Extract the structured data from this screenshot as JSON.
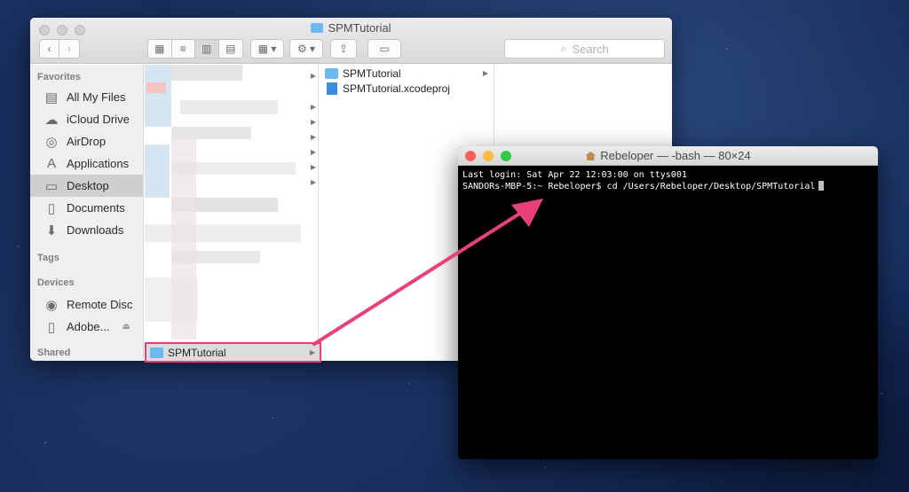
{
  "finder": {
    "title": "SPMTutorial",
    "search_placeholder": "Search",
    "sidebar": {
      "favorites_header": "Favorites",
      "favorites": [
        {
          "label": "All My Files",
          "icon": "all-files-icon"
        },
        {
          "label": "iCloud Drive",
          "icon": "cloud-icon"
        },
        {
          "label": "AirDrop",
          "icon": "airdrop-icon"
        },
        {
          "label": "Applications",
          "icon": "applications-icon"
        },
        {
          "label": "Desktop",
          "icon": "desktop-icon",
          "selected": true
        },
        {
          "label": "Documents",
          "icon": "documents-icon"
        },
        {
          "label": "Downloads",
          "icon": "downloads-icon"
        }
      ],
      "tags_header": "Tags",
      "devices_header": "Devices",
      "devices": [
        {
          "label": "Remote Disc",
          "icon": "disc-icon"
        },
        {
          "label": "Adobe...",
          "icon": "drive-icon"
        }
      ],
      "shared_header": "Shared"
    },
    "column1_selected": "SPMTutorial",
    "column2_items": [
      {
        "label": "SPMTutorial",
        "type": "folder"
      },
      {
        "label": "SPMTutorial.xcodeproj",
        "type": "xcodeproj"
      }
    ]
  },
  "terminal": {
    "title": "Rebeloper — -bash — 80×24",
    "line1": "Last login: Sat Apr 22 12:03:00 on ttys001",
    "line2": "SANDORs-MBP-5:~ Rebeloper$ cd /Users/Rebeloper/Desktop/SPMTutorial"
  },
  "colors": {
    "annotation": "#e8407a",
    "folder": "#6db9ef",
    "close": "#fc605c",
    "minimize": "#fdbc40",
    "zoom": "#34c84a"
  }
}
